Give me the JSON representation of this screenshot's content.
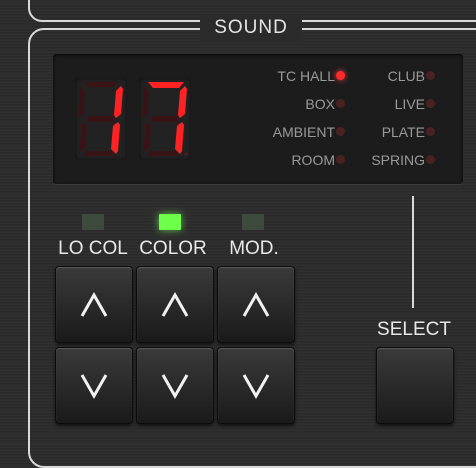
{
  "section": {
    "title": "SOUND"
  },
  "display": {
    "preset_number": "17",
    "active_mode": "TC HALL"
  },
  "modes_left": [
    {
      "label": "TC HALL",
      "active": true
    },
    {
      "label": "BOX",
      "active": false
    },
    {
      "label": "AMBIENT",
      "active": false
    },
    {
      "label": "ROOM",
      "active": false
    }
  ],
  "modes_right": [
    {
      "label": "CLUB",
      "active": false
    },
    {
      "label": "LIVE",
      "active": false
    },
    {
      "label": "PLATE",
      "active": false
    },
    {
      "label": "SPRING",
      "active": false
    }
  ],
  "columns": [
    {
      "label": "LO COL",
      "led_on": false
    },
    {
      "label": "COLOR",
      "led_on": true
    },
    {
      "label": "MOD.",
      "led_on": false
    }
  ],
  "select": {
    "label": "SELECT"
  },
  "colors": {
    "led_red": "#ff2a2a",
    "led_green": "#6dff4a",
    "panel": "#2b2b2b"
  }
}
